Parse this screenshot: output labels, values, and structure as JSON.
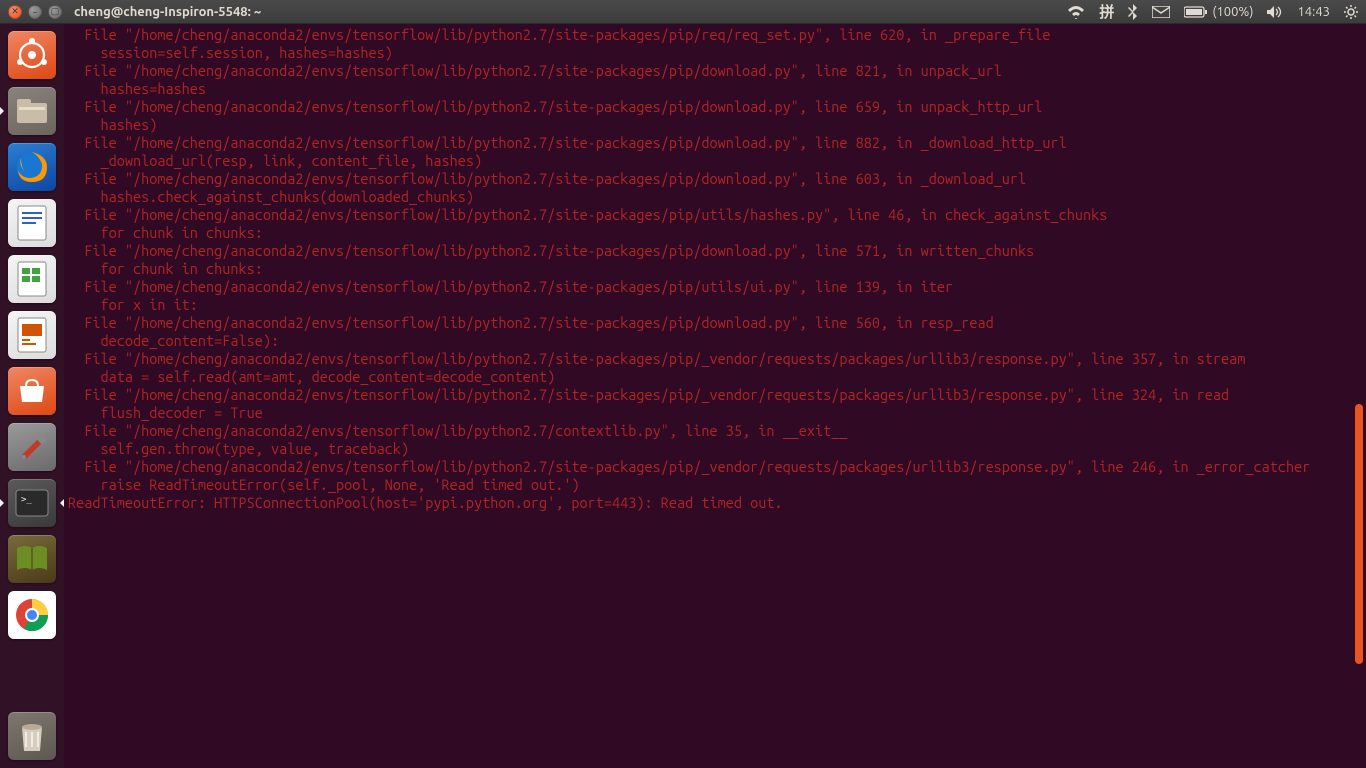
{
  "topbar": {
    "title": "cheng@cheng-Inspiron-5548: ~",
    "battery": "(100%)",
    "time": "14:43",
    "ime": "拼"
  },
  "launcher": {
    "items": [
      {
        "name": "dash",
        "color": "#dd4814"
      },
      {
        "name": "files",
        "color": "#6b6560"
      },
      {
        "name": "firefox",
        "color": "#1565c0"
      },
      {
        "name": "writer",
        "color": "#e8e8e8"
      },
      {
        "name": "calc",
        "color": "#e8e8e8"
      },
      {
        "name": "impress",
        "color": "#e8e8e8"
      },
      {
        "name": "software",
        "color": "#dd4814"
      },
      {
        "name": "settings",
        "color": "#7a7a7a"
      },
      {
        "name": "terminal",
        "color": "#4a4a4a"
      },
      {
        "name": "book",
        "color": "#5a4a2a"
      },
      {
        "name": "chrome",
        "color": "#ffffff"
      }
    ],
    "trash": {
      "name": "trash"
    }
  },
  "terminal": {
    "lines": [
      "  File \"/home/cheng/anaconda2/envs/tensorflow/lib/python2.7/site-packages/pip/req/req_set.py\", line 620, in _prepare_file",
      "    session=self.session, hashes=hashes)",
      "  File \"/home/cheng/anaconda2/envs/tensorflow/lib/python2.7/site-packages/pip/download.py\", line 821, in unpack_url",
      "    hashes=hashes",
      "  File \"/home/cheng/anaconda2/envs/tensorflow/lib/python2.7/site-packages/pip/download.py\", line 659, in unpack_http_url",
      "    hashes)",
      "  File \"/home/cheng/anaconda2/envs/tensorflow/lib/python2.7/site-packages/pip/download.py\", line 882, in _download_http_url",
      "    _download_url(resp, link, content_file, hashes)",
      "  File \"/home/cheng/anaconda2/envs/tensorflow/lib/python2.7/site-packages/pip/download.py\", line 603, in _download_url",
      "    hashes.check_against_chunks(downloaded_chunks)",
      "  File \"/home/cheng/anaconda2/envs/tensorflow/lib/python2.7/site-packages/pip/utils/hashes.py\", line 46, in check_against_chunks",
      "    for chunk in chunks:",
      "  File \"/home/cheng/anaconda2/envs/tensorflow/lib/python2.7/site-packages/pip/download.py\", line 571, in written_chunks",
      "    for chunk in chunks:",
      "  File \"/home/cheng/anaconda2/envs/tensorflow/lib/python2.7/site-packages/pip/utils/ui.py\", line 139, in iter",
      "    for x in it:",
      "  File \"/home/cheng/anaconda2/envs/tensorflow/lib/python2.7/site-packages/pip/download.py\", line 560, in resp_read",
      "    decode_content=False):",
      "  File \"/home/cheng/anaconda2/envs/tensorflow/lib/python2.7/site-packages/pip/_vendor/requests/packages/urllib3/response.py\", line 357, in stream",
      "    data = self.read(amt=amt, decode_content=decode_content)",
      "  File \"/home/cheng/anaconda2/envs/tensorflow/lib/python2.7/site-packages/pip/_vendor/requests/packages/urllib3/response.py\", line 324, in read",
      "    flush_decoder = True",
      "  File \"/home/cheng/anaconda2/envs/tensorflow/lib/python2.7/contextlib.py\", line 35, in __exit__",
      "    self.gen.throw(type, value, traceback)",
      "  File \"/home/cheng/anaconda2/envs/tensorflow/lib/python2.7/site-packages/pip/_vendor/requests/packages/urllib3/response.py\", line 246, in _error_catcher",
      "    raise ReadTimeoutError(self._pool, None, 'Read timed out.')",
      "ReadTimeoutError: HTTPSConnectionPool(host='pypi.python.org', port=443): Read timed out."
    ]
  }
}
